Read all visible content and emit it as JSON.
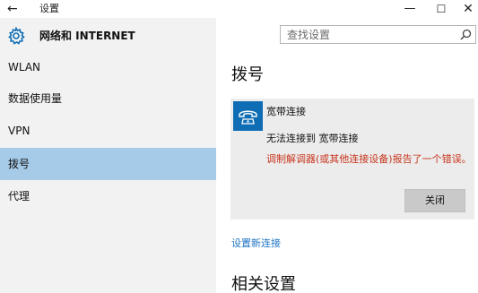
{
  "window": {
    "back_glyph": "←",
    "title": "设置",
    "min_glyph": "—",
    "max_glyph": "☐",
    "close_glyph": "✕"
  },
  "sidebar": {
    "header_title": "网络和 INTERNET",
    "items": [
      {
        "label": "WLAN",
        "active": false
      },
      {
        "label": "数据使用量",
        "active": false
      },
      {
        "label": "VPN",
        "active": false
      },
      {
        "label": "拨号",
        "active": true
      },
      {
        "label": "代理",
        "active": false
      }
    ]
  },
  "search": {
    "placeholder": "查找设置"
  },
  "main": {
    "title": "拨号",
    "connection": {
      "name": "宽带连接",
      "status": "无法连接到 宽带连接",
      "error": "调制解调器(或其他连接设备)报告了一个错误。",
      "close_label": "关闭"
    },
    "setup_link": "设置新连接",
    "related_title": "相关设置"
  },
  "colors": {
    "accent": "#0f6db5",
    "active_item": "#a6cbe8",
    "error_text": "#c8351d",
    "link": "#1d74c4"
  }
}
